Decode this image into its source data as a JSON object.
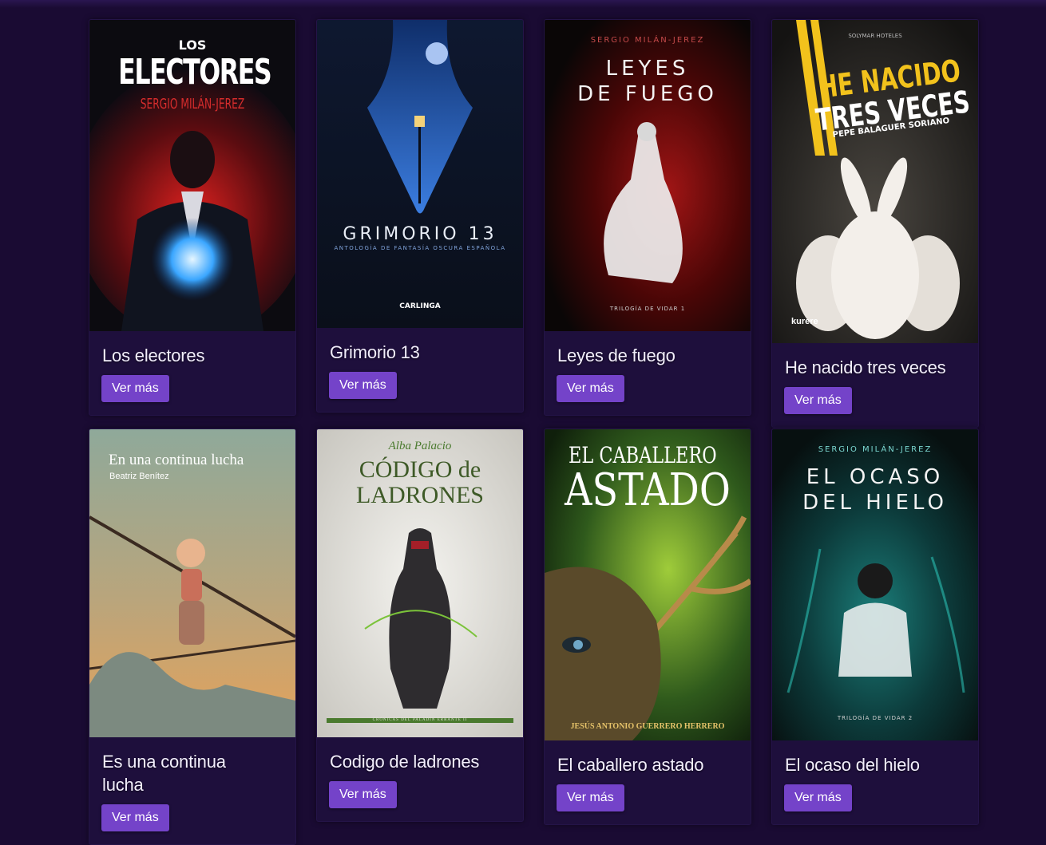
{
  "books": [
    {
      "title": "Los electores",
      "button": "Ver más",
      "cover": {
        "top": "LOS",
        "main": "ELECTORES",
        "author": "SERGIO MILÁN-JEREZ"
      }
    },
    {
      "title": "Grimorio 13",
      "button": "Ver más",
      "cover": {
        "main": "GRIMORIO 13",
        "subtitle": "ANTOLOGÍA DE FANTASÍA OSCURA ESPAÑOLA",
        "publisher": "CARLINGA"
      }
    },
    {
      "title": "Leyes de fuego",
      "button": "Ver más",
      "cover": {
        "author": "SERGIO MILÁN-JEREZ",
        "line1": "LEYES",
        "line2": "DE FUEGO",
        "series": "TRILOGÍA DE VIDAR 1"
      }
    },
    {
      "title": "He nacido tres veces",
      "button": "Ver más",
      "cover": {
        "sponsor": "SOLYMAR HOTELES",
        "line1": "HE NACIDO",
        "line2": "TRES VECES",
        "author": "PEPE BALAGUER SORIANO",
        "publisher": "kurere"
      }
    },
    {
      "title": "Es una continua lucha",
      "button": "Ver más",
      "cover": {
        "main": "En una continua lucha",
        "author": "Beatriz Benítez"
      }
    },
    {
      "title": "Codigo de ladrones",
      "button": "Ver más",
      "cover": {
        "author": "Alba Palacio",
        "line1": "CÓDIGO de",
        "line2": "LADRONES",
        "series": "CRÓNICAS DEL PALADÍN ERRANTE II"
      }
    },
    {
      "title": "El caballero astado",
      "button": "Ver más",
      "cover": {
        "line1": "EL CABALLERO",
        "line2": "ASTADO",
        "author": "JESÚS ANTONIO GUERRERO HERRERO"
      }
    },
    {
      "title": "El ocaso del hielo",
      "button": "Ver más",
      "cover": {
        "author": "SERGIO MILÁN-JEREZ",
        "line1": "EL OCASO",
        "line2": "DEL HIELO",
        "series": "TRILOGÍA DE VIDAR 2"
      }
    }
  ],
  "colors": {
    "background": "#1a0b33",
    "card": "#1e0f3c",
    "button": "#7443c9"
  }
}
